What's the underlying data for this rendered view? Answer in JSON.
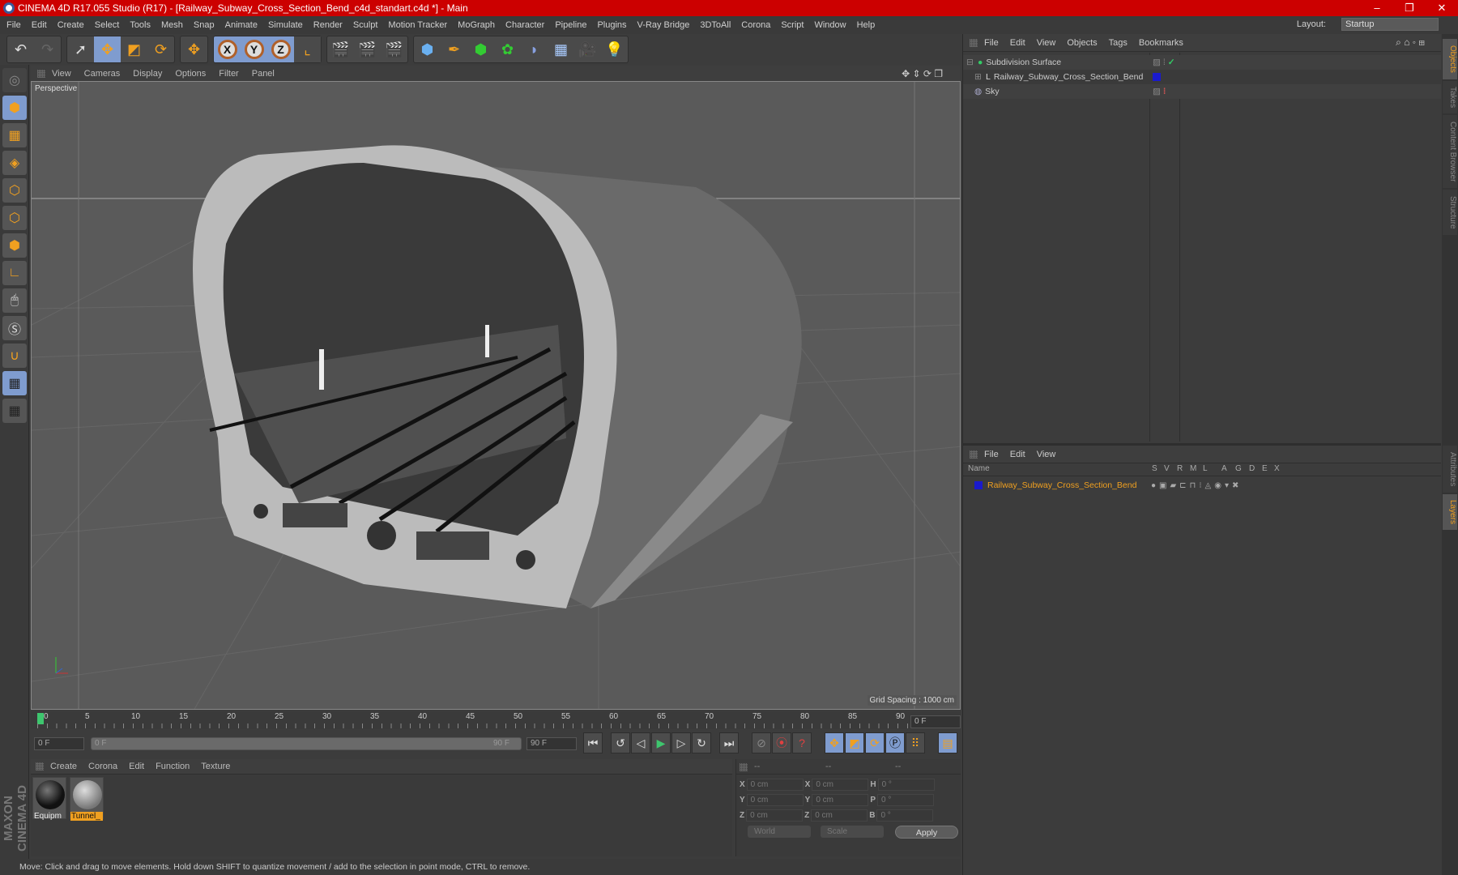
{
  "window": {
    "title": "CINEMA 4D R17.055 Studio (R17) - [Railway_Subway_Cross_Section_Bend_c4d_standart.c4d *] - Main",
    "controls": [
      "–",
      "❐",
      "✕"
    ]
  },
  "menubar": {
    "items": [
      "File",
      "Edit",
      "Create",
      "Select",
      "Tools",
      "Mesh",
      "Snap",
      "Animate",
      "Simulate",
      "Render",
      "Sculpt",
      "Motion Tracker",
      "MoGraph",
      "Character",
      "Pipeline",
      "Plugins",
      "V-Ray Bridge",
      "3DToAll",
      "Corona",
      "Script",
      "Window",
      "Help"
    ],
    "layout_label": "Layout:",
    "layout_value": "Startup"
  },
  "toolbar": {
    "axis": [
      "X",
      "Y",
      "Z"
    ]
  },
  "viewport": {
    "menu": [
      "View",
      "Cameras",
      "Display",
      "Options",
      "Filter",
      "Panel"
    ],
    "label": "Perspective",
    "grid_spacing": "Grid Spacing : 1000 cm"
  },
  "timeline": {
    "ticks": [
      "0",
      "5",
      "10",
      "15",
      "20",
      "25",
      "30",
      "35",
      "40",
      "45",
      "50",
      "55",
      "60",
      "65",
      "70",
      "75",
      "80",
      "85",
      "90"
    ],
    "current_frame": "0 F",
    "start": "0 F",
    "range_start": "0 F",
    "range_end": "90 F",
    "end": "90 F"
  },
  "materials": {
    "menu": [
      "Create",
      "Corona",
      "Edit",
      "Function",
      "Texture"
    ],
    "items": [
      {
        "name": "Equipm"
      },
      {
        "name": "Tunnel_"
      }
    ]
  },
  "coordinates": {
    "headers": [
      "--",
      "--",
      "--"
    ],
    "rows": [
      {
        "a": "X",
        "av": "0 cm",
        "b": "X",
        "bv": "0 cm",
        "c": "H",
        "cv": "0 °"
      },
      {
        "a": "Y",
        "av": "0 cm",
        "b": "Y",
        "bv": "0 cm",
        "c": "P",
        "cv": "0 °"
      },
      {
        "a": "Z",
        "av": "0 cm",
        "b": "Z",
        "bv": "0 cm",
        "c": "B",
        "cv": "0 °"
      }
    ],
    "mode": "World",
    "type": "Scale",
    "apply": "Apply"
  },
  "status": "Move: Click and drag to move elements. Hold down SHIFT to quantize movement / add to the selection in point mode, CTRL to remove.",
  "objects": {
    "menu": [
      "File",
      "Edit",
      "View",
      "Objects",
      "Tags",
      "Bookmarks"
    ],
    "items": [
      {
        "name": "Subdivision Surface"
      },
      {
        "name": "Railway_Subway_Cross_Section_Bend"
      },
      {
        "name": "Sky"
      }
    ]
  },
  "layers": {
    "menu": [
      "File",
      "Edit",
      "View"
    ],
    "columns": [
      "Name",
      "S",
      "V",
      "R",
      "M",
      "L",
      "A",
      "G",
      "D",
      "E",
      "X"
    ],
    "items": [
      {
        "name": "Railway_Subway_Cross_Section_Bend",
        "color": "#1a1acc"
      }
    ]
  },
  "right_tabs": [
    "Objects",
    "Takes",
    "Content Browser",
    "Structure",
    "Attributes",
    "Layers"
  ],
  "branding": "MAXON CINEMA 4D"
}
